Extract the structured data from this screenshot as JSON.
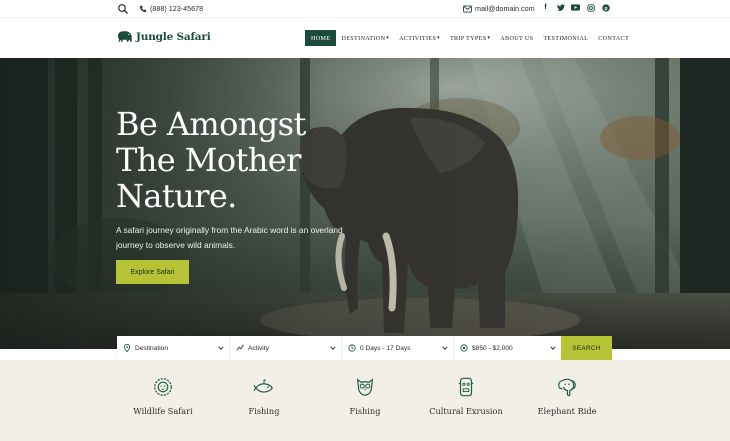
{
  "topbar": {
    "phone": "(888) 123-45678",
    "email": "mail@domain.com",
    "socials": [
      "facebook-icon",
      "twitter-icon",
      "youtube-icon",
      "instagram-icon",
      "pinterest-icon"
    ]
  },
  "header": {
    "logo_text": "Jungle Safari",
    "nav": [
      {
        "label": "HOME",
        "active": true,
        "dropdown": false
      },
      {
        "label": "DESTINATION",
        "active": false,
        "dropdown": true
      },
      {
        "label": "ACTIVITIES",
        "active": false,
        "dropdown": true
      },
      {
        "label": "TRIP TYPES",
        "active": false,
        "dropdown": true
      },
      {
        "label": "ABOUT US",
        "active": false,
        "dropdown": false
      },
      {
        "label": "TESTIMONIAL",
        "active": false,
        "dropdown": false
      },
      {
        "label": "CONTACT",
        "active": false,
        "dropdown": false
      }
    ]
  },
  "hero": {
    "title_lines": [
      "Be Amongst",
      "The Mother",
      "Nature."
    ],
    "subtitle": "A safari journey originally from the Arabic word is an overland journey to observe wild animals.",
    "cta_label": "Explore Safari"
  },
  "search": {
    "destination": "Destination",
    "activity": "Activity",
    "duration": "0 Days - 17 Days",
    "price": "$850 - $2,000",
    "button_label": "SEARCH"
  },
  "categories": [
    {
      "label": "Wildlife Safari",
      "icon": "lion-icon"
    },
    {
      "label": "Fishing",
      "icon": "fish-icon"
    },
    {
      "label": "Fishing",
      "icon": "owl-icon"
    },
    {
      "label": "Cultural Exrusion",
      "icon": "totem-icon"
    },
    {
      "label": "Elephant Ride",
      "icon": "elephant-icon"
    }
  ],
  "colors": {
    "brand_green": "#1c4a3c",
    "accent_lime": "#b5c334",
    "category_bg": "#f2f0e6"
  }
}
